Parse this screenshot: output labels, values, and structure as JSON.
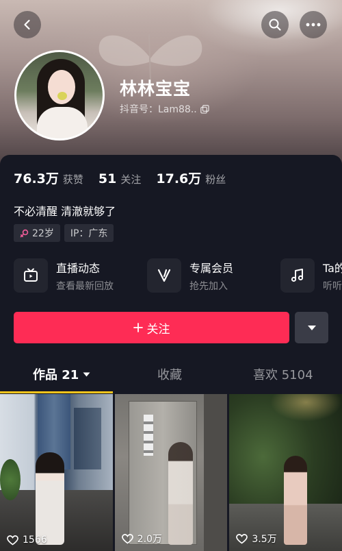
{
  "header": {
    "username": "林林宝宝",
    "douyin_id": "抖音号：Lam88.."
  },
  "stats": [
    {
      "value": "76.3万",
      "label": "获赞"
    },
    {
      "value": "51",
      "label": "关注"
    },
    {
      "value": "17.6万",
      "label": "粉丝"
    }
  ],
  "bio": "不必清醒 清澈就够了",
  "tags": {
    "age": "22岁",
    "ip": "IP：广东"
  },
  "features": [
    {
      "title": "直播动态",
      "subtitle": "查看最新回放",
      "icon": "tv-icon"
    },
    {
      "title": "专属会员",
      "subtitle": "抢先加入",
      "icon": "v-icon"
    },
    {
      "title": "Ta的音乐",
      "subtitle": "听听ta的",
      "icon": "music-note-icon"
    }
  ],
  "actions": {
    "follow_label": "关注"
  },
  "tabs": {
    "works": "作品 21",
    "favorites": "收藏",
    "likes": "喜欢 5104"
  },
  "videos": [
    {
      "likes": "1566"
    },
    {
      "likes": "2.0万"
    },
    {
      "likes": "3.5万"
    }
  ],
  "colors": {
    "accent": "#fe2c55",
    "tab_underline": "#f7c51c",
    "background": "#161823"
  }
}
